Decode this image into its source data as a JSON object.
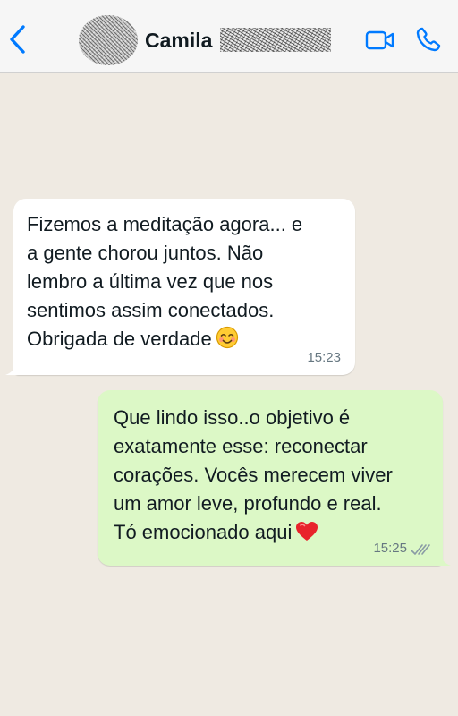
{
  "header": {
    "contact_name": "Camila",
    "back_icon": "chevron-left-icon",
    "video_icon": "video-camera-icon",
    "call_icon": "phone-icon",
    "accent_color": "#007aff"
  },
  "messages": [
    {
      "direction": "incoming",
      "lines": [
        "Fizemos a meditação agora... e",
        "a gente chorou juntos. Não",
        "lembro a última vez que nos",
        "sentimos assim conectados.",
        "Obrigada de verdade"
      ],
      "emoji": "smiling-face-with-smiling-eyes",
      "time": "15:23"
    },
    {
      "direction": "outgoing",
      "lines": [
        "Que lindo isso..o objetivo é",
        "exatamente esse: reconectar",
        "corações. Vocês merecem viver",
        "um amor leve, profundo e real.",
        "Tó emocionado aqui"
      ],
      "emoji": "red-heart",
      "time": "15:25",
      "status": "read-double-check"
    }
  ],
  "colors": {
    "chat_background": "#efeae2",
    "incoming_bubble": "#ffffff",
    "outgoing_bubble": "#dcf8c6",
    "timestamp": "#667781"
  }
}
